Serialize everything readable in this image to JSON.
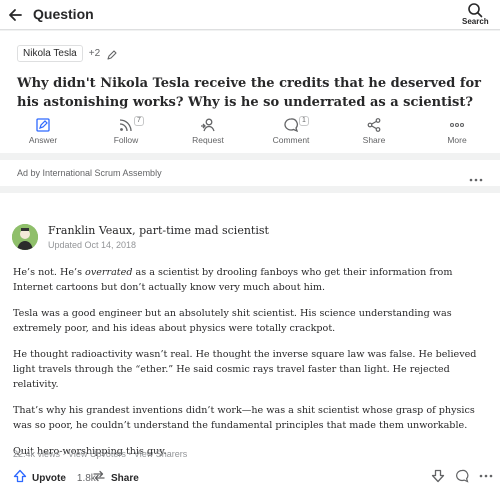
{
  "topbar": {
    "title": "Question",
    "search_label": "Search"
  },
  "question": {
    "topics": [
      "Nikola Tesla"
    ],
    "more_topics": "+2",
    "title": "Why didn't Nikola Tesla receive the credits that he deserved for his astonishing works? Why is he so underrated as a scientist?"
  },
  "actions": {
    "answer": "Answer",
    "follow": "Follow",
    "follow_count": "7",
    "request": "Request",
    "comment": "Comment",
    "comment_count": "1",
    "share": "Share",
    "more": "More"
  },
  "ad": {
    "text": "Ad by International Scrum Assembly"
  },
  "answer": {
    "author": "Franklin Veaux, part-time mad scientist",
    "updated": "Updated Oct 14, 2018",
    "p1_a": "He’s not. He’s ",
    "p1_em": "overrated",
    "p1_b": " as a scientist by drooling fanboys who get their information from Internet cartoons but don’t actually know very much about him.",
    "p2": "Tesla was a good engineer but an absolutely shit scientist. His science understanding was extremely poor, and his ideas about physics were totally crackpot.",
    "p3": "He thought radioactivity wasn’t real. He thought the inverse square law was false. He believed light travels through the “ether.” He said cosmic rays travel faster than light. He rejected relativity.",
    "p4": "That’s why his grandest inventions didn’t work—he was a shit scientist whose grasp of physics was so poor, he couldn’t understand the fundamental principles that made them unworkable.",
    "p5": "Quit hero-worshipping this guy.",
    "views": "22.4k views",
    "sep": " · ",
    "view_upvoters": "View Upvoters",
    "view_sharers": "View Sharers",
    "upvote_label": "Upvote",
    "upvote_count": "1.8k",
    "share_label": "Share"
  },
  "colors": {
    "accent": "#2e69ff",
    "muted": "#636466",
    "bg": "#f1f2f2"
  }
}
